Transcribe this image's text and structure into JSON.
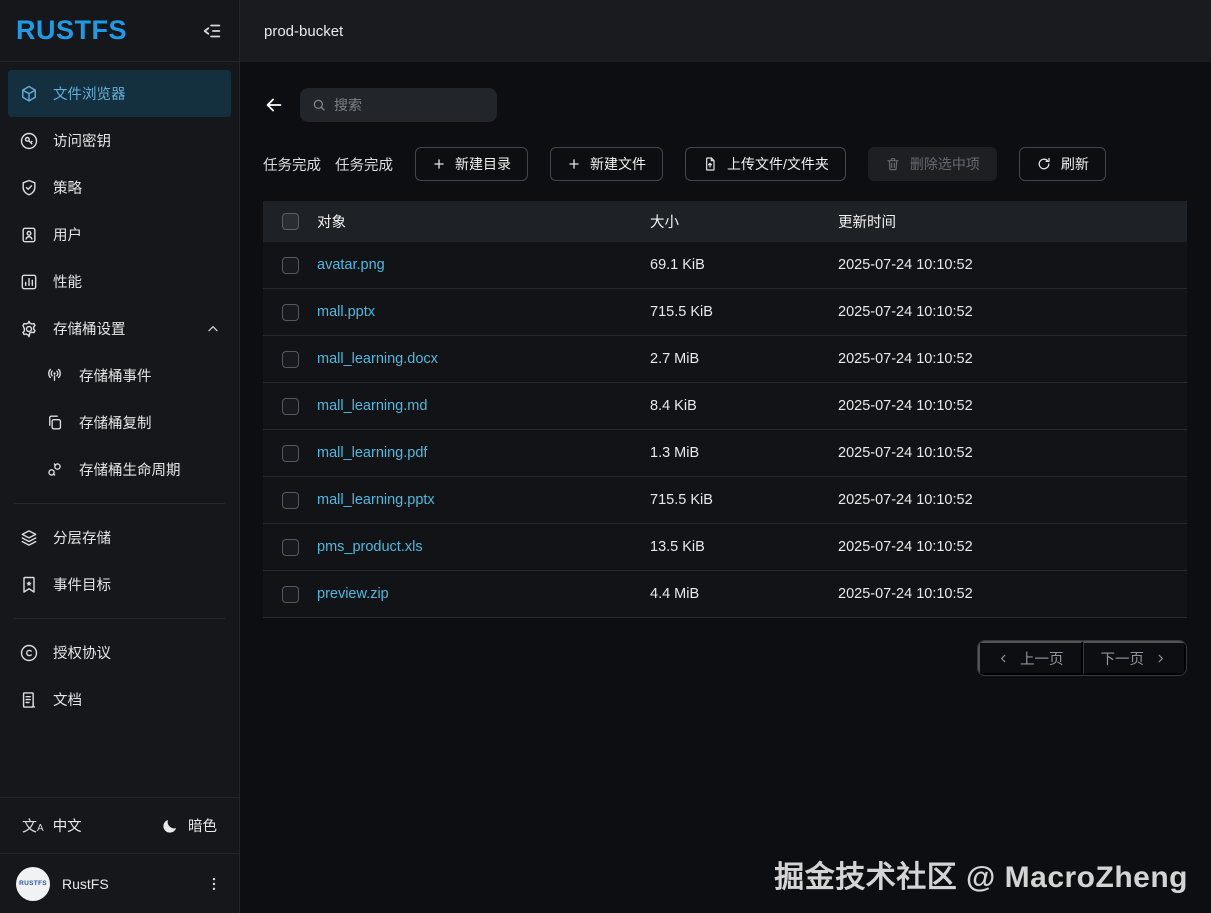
{
  "app": {
    "logo": "RUSTFS"
  },
  "colors": {
    "accent": "#1e9be6",
    "link": "#4cb9de",
    "active_nav_bg": "#14303f",
    "sidebar_bg": "#16171a",
    "topbar_bg": "#1a1b1f",
    "content_bg": "#0d0e11"
  },
  "header": {
    "title": "prod-bucket"
  },
  "sidebar": {
    "items": [
      {
        "label": "文件浏览器",
        "icon": "cube-icon",
        "active": true
      },
      {
        "label": "访问密钥",
        "icon": "key-icon"
      },
      {
        "label": "策略",
        "icon": "shield-check-icon"
      },
      {
        "label": "用户",
        "icon": "user-card-icon"
      },
      {
        "label": "性能",
        "icon": "bar-chart-icon"
      },
      {
        "label": "存储桶设置",
        "icon": "gear-icon",
        "expanded": true
      },
      {
        "label": "存储桶事件",
        "icon": "broadcast-icon",
        "sub": true
      },
      {
        "label": "存储桶复制",
        "icon": "copy-icon",
        "sub": true
      },
      {
        "label": "存储桶生命周期",
        "icon": "lifecycle-icon",
        "sub": true
      },
      {
        "label": "分层存储",
        "icon": "layers-icon"
      },
      {
        "label": "事件目标",
        "icon": "bookmark-star-icon"
      },
      {
        "label": "授权协议",
        "icon": "copyright-icon"
      },
      {
        "label": "文档",
        "icon": "document-icon"
      }
    ],
    "footer": {
      "language": "中文",
      "theme": "暗色",
      "account": "RustFS"
    }
  },
  "search": {
    "placeholder": "搜索"
  },
  "toolbar": {
    "task_labels": [
      "任务完成",
      "任务完成"
    ],
    "new_dir": "新建目录",
    "new_file": "新建文件",
    "upload": "上传文件/文件夹",
    "delete_selected": "删除选中项",
    "refresh": "刷新"
  },
  "table": {
    "columns": {
      "object": "对象",
      "size": "大小",
      "updated": "更新时间"
    },
    "rows": [
      {
        "name": "avatar.png",
        "size": "69.1 KiB",
        "updated": "2025-07-24 10:10:52"
      },
      {
        "name": "mall.pptx",
        "size": "715.5 KiB",
        "updated": "2025-07-24 10:10:52"
      },
      {
        "name": "mall_learning.docx",
        "size": "2.7 MiB",
        "updated": "2025-07-24 10:10:52"
      },
      {
        "name": "mall_learning.md",
        "size": "8.4 KiB",
        "updated": "2025-07-24 10:10:52"
      },
      {
        "name": "mall_learning.pdf",
        "size": "1.3 MiB",
        "updated": "2025-07-24 10:10:52"
      },
      {
        "name": "mall_learning.pptx",
        "size": "715.5 KiB",
        "updated": "2025-07-24 10:10:52"
      },
      {
        "name": "pms_product.xls",
        "size": "13.5 KiB",
        "updated": "2025-07-24 10:10:52"
      },
      {
        "name": "preview.zip",
        "size": "4.4 MiB",
        "updated": "2025-07-24 10:10:52"
      }
    ]
  },
  "pagination": {
    "prev": "上一页",
    "next": "下一页"
  },
  "watermark": "掘金技术社区 @ MacroZheng"
}
